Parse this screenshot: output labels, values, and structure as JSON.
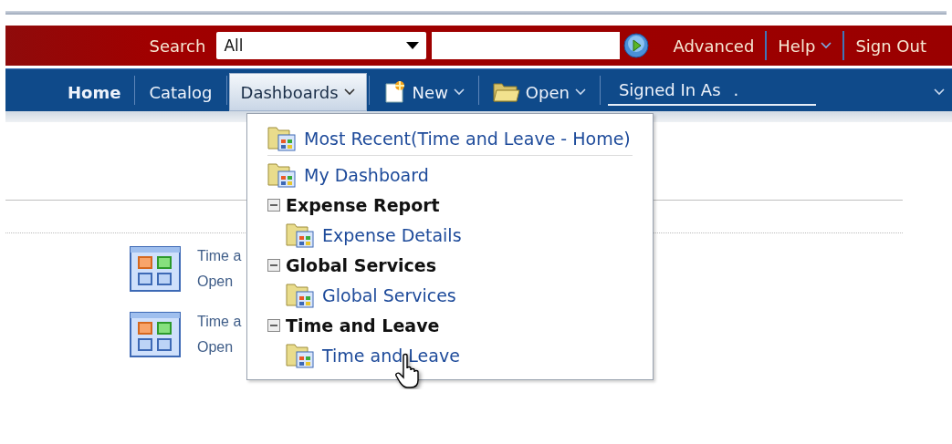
{
  "header": {
    "search_label": "Search",
    "scope": "All",
    "links": [
      {
        "label": "Advanced",
        "kind": "link"
      },
      {
        "label": "Help",
        "kind": "menu"
      },
      {
        "label": "Sign Out",
        "kind": "link"
      }
    ]
  },
  "nav": {
    "items": [
      {
        "label": "Home",
        "kind": "link",
        "current": true,
        "selected": false
      },
      {
        "label": "Catalog",
        "kind": "link",
        "current": false,
        "selected": false
      },
      {
        "label": "Dashboards",
        "kind": "menu",
        "current": false,
        "selected": true
      },
      {
        "label": "New",
        "kind": "new",
        "current": false,
        "selected": false
      },
      {
        "label": "Open",
        "kind": "open",
        "current": false,
        "selected": false
      }
    ],
    "signed_in": {
      "label": "Signed In As",
      "value": "."
    }
  },
  "content": {
    "tiles": [
      {
        "title": "Time a",
        "action": "Open"
      },
      {
        "title": "Time a",
        "action": "Open"
      }
    ]
  },
  "dashboards_menu": {
    "items": [
      {
        "kind": "recent",
        "label": "Most Recent(Time and Leave - Home)"
      },
      {
        "kind": "dashboard",
        "label": "My Dashboard"
      },
      {
        "kind": "group",
        "label": "Expense Report",
        "expanded": true,
        "children": [
          {
            "label": "Expense Details",
            "hovered": false
          }
        ]
      },
      {
        "kind": "group",
        "label": "Global Services",
        "expanded": true,
        "children": [
          {
            "label": "Global Services",
            "hovered": false
          }
        ]
      },
      {
        "kind": "group",
        "label": "Time and Leave",
        "expanded": true,
        "children": [
          {
            "label": "Time and Leave",
            "hovered": true
          }
        ]
      }
    ]
  }
}
